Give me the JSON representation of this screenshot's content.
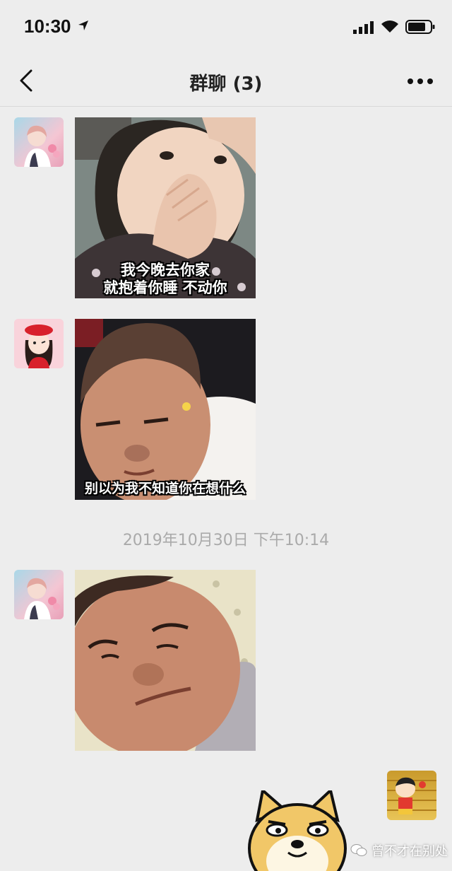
{
  "status_bar": {
    "time": "10:30"
  },
  "header": {
    "title": "群聊 (3)"
  },
  "messages": {
    "m1": {
      "caption_line1": "我今晚去你家",
      "caption_line2": "就抱着你睡  不动你"
    },
    "m2": {
      "caption": "别以为我不知道你在想什么"
    },
    "m3": {}
  },
  "timestamp": "2019年10月30日 下午10:14",
  "watermark": "曾不才在别处",
  "colors": {
    "background": "#ededed",
    "nav_border": "#d9d9d9",
    "timestamp_text": "#aaaaaa"
  }
}
